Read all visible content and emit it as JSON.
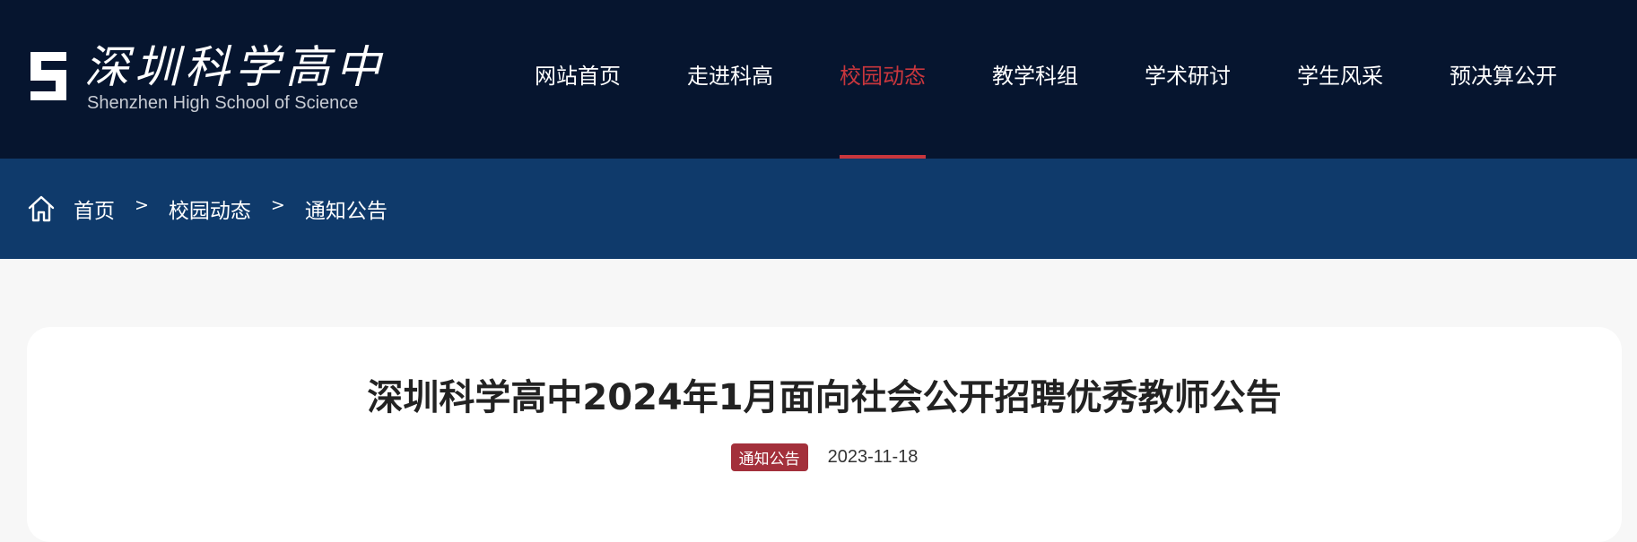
{
  "colors": {
    "header_bg": "#06152f",
    "breadcrumb_bg": "#0f3a6b",
    "accent_red": "#c8363d",
    "tag_bg": "#a3303b",
    "page_bg": "#f7f7f7",
    "card_bg": "#ffffff"
  },
  "header": {
    "logo": {
      "cn": "深圳科学高中",
      "en": "Shenzhen High School of Science",
      "icon": "s-emblem-icon"
    },
    "nav": [
      {
        "label": "网站首页",
        "active": false
      },
      {
        "label": "走进科高",
        "active": false
      },
      {
        "label": "校园动态",
        "active": true
      },
      {
        "label": "教学科组",
        "active": false
      },
      {
        "label": "学术研讨",
        "active": false
      },
      {
        "label": "学生风采",
        "active": false
      },
      {
        "label": "预决算公开",
        "active": false
      }
    ]
  },
  "breadcrumb": {
    "icon": "home-icon",
    "separator": ">",
    "items": [
      "首页",
      "校园动态",
      "通知公告"
    ]
  },
  "article": {
    "title": "深圳科学高中2024年1月面向社会公开招聘优秀教师公告",
    "category": "通知公告",
    "date": "2023-11-18"
  }
}
